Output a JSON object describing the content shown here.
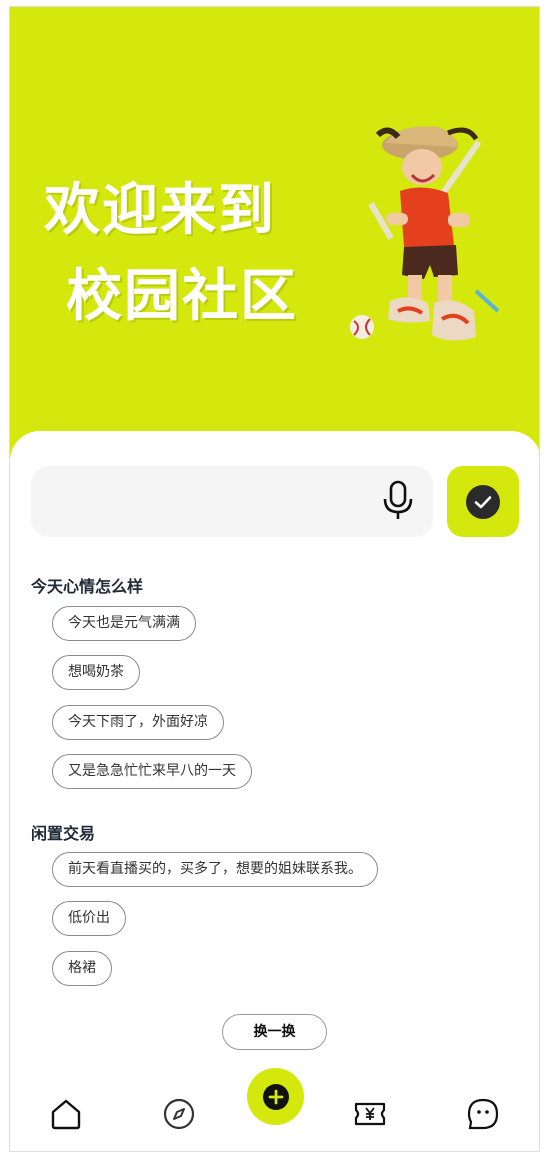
{
  "hero": {
    "title_line1": "欢迎来到",
    "title_line2": "校园社区",
    "background_color": "#d4e80d",
    "mascot_icon": "cartoon-character-illustration"
  },
  "search": {
    "value": "",
    "placeholder": "",
    "mic_icon": "microphone-icon",
    "confirm_icon": "check-circle-icon"
  },
  "sections": [
    {
      "title": "今天心情怎么样",
      "chips": [
        "今天也是元气满满",
        "想喝奶茶",
        "今天下雨了，外面好凉",
        "又是急急忙忙来早八的一天"
      ]
    },
    {
      "title": "闲置交易",
      "chips": [
        "前天看直播买的，买多了，想要的姐妹联系我。",
        "低价出",
        "格裙"
      ]
    }
  ],
  "refresh_label": "换一换",
  "tabbar": {
    "items": [
      "home-icon",
      "compass-icon",
      "add-icon",
      "ticket-yen-icon",
      "chat-face-icon"
    ],
    "accent_color": "#d4e80d"
  }
}
